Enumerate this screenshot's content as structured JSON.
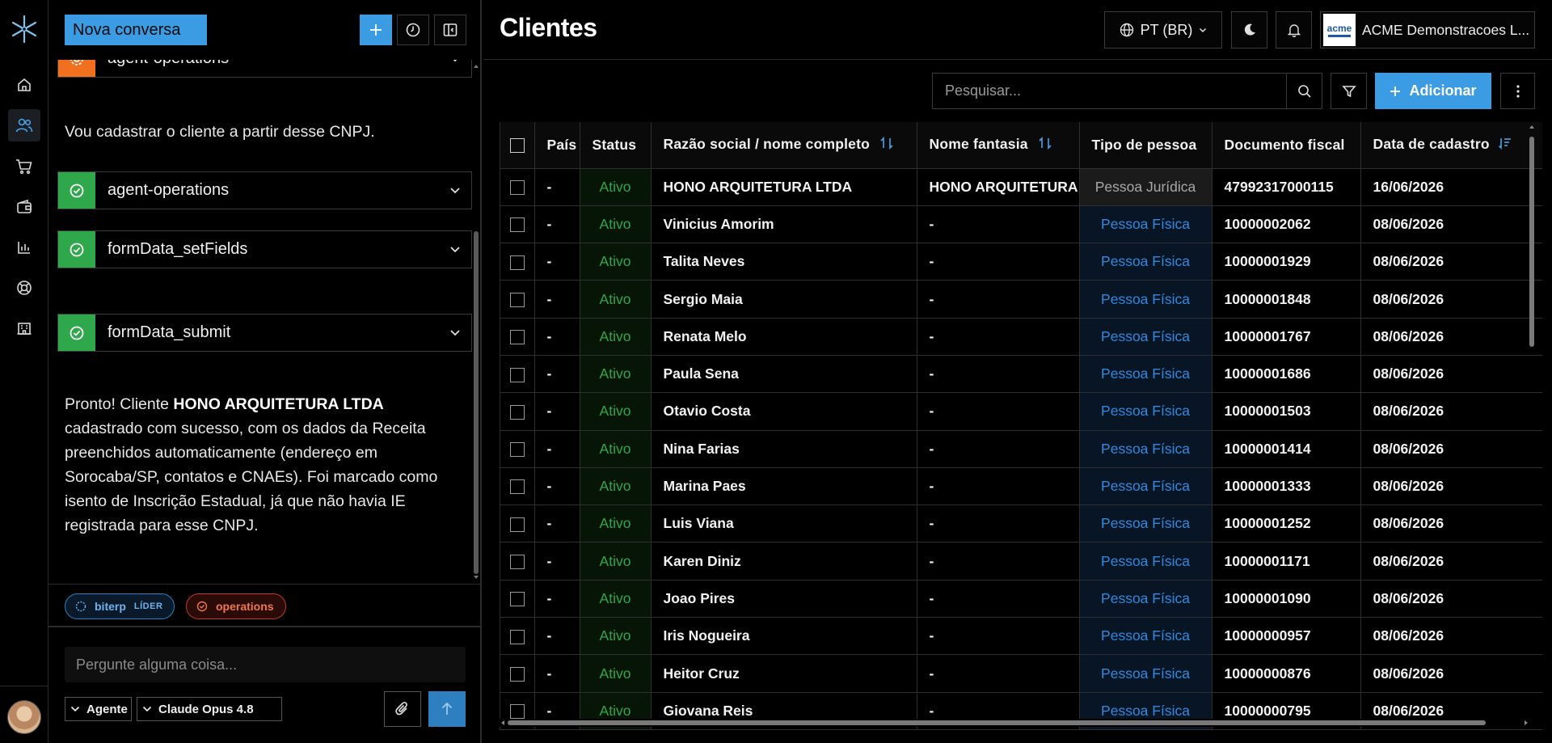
{
  "sidebar": {
    "nav": [
      {
        "icon": "home-icon"
      },
      {
        "icon": "users-icon",
        "active": true
      },
      {
        "icon": "cart-icon"
      },
      {
        "icon": "wallet-icon"
      },
      {
        "icon": "bar-chart-icon"
      },
      {
        "icon": "lifebuoy-icon"
      },
      {
        "icon": "building-icon"
      }
    ]
  },
  "chat": {
    "new_conversation": "Nova conversa",
    "tools": {
      "top_partial": "agent-operations",
      "t1": "agent-operations",
      "t2": "formData_setFields",
      "t3": "formData_submit"
    },
    "message1": "Vou cadastrar o cliente a partir desse CNPJ.",
    "message2": {
      "prefix": "Pronto! Cliente ",
      "bold": "HONO ARQUITETURA LTDA",
      "suffix": " cadastrado com sucesso, com os dados da Receita preenchidos automaticamente (endereço em Sorocaba/SP, contatos e CNAEs). Foi marcado como isento de Inscrição Estadual, já que não havia IE registrada para esse CNPJ."
    },
    "chips": {
      "agent1": "biterp",
      "agent1_role": "LÍDER",
      "agent2": "operations"
    },
    "input_placeholder": "Pergunte alguma coisa...",
    "mode": "Agente",
    "model": "Claude Opus 4.8"
  },
  "header": {
    "title": "Clientes",
    "language": "PT (BR)",
    "org": "ACME Demonstracoes L...",
    "org_logo_text": "acme"
  },
  "toolbar": {
    "search_placeholder": "Pesquisar...",
    "add_label": "Adicionar"
  },
  "table": {
    "columns": [
      "País",
      "Status",
      "Razão social / nome completo",
      "Nome fantasia",
      "Tipo de pessoa",
      "Documento fiscal",
      "Data de cadastro"
    ],
    "rows": [
      {
        "pais": "-",
        "status": "Ativo",
        "razao": "HONO ARQUITETURA LTDA",
        "fantasia": "HONO ARQUITETURA",
        "tipo": "Pessoa Jurídica",
        "doc": "47992317000115",
        "data": "16/06/2026"
      },
      {
        "pais": "-",
        "status": "Ativo",
        "razao": "Vinicius Amorim",
        "fantasia": "-",
        "tipo": "Pessoa Física",
        "doc": "10000002062",
        "data": "08/06/2026"
      },
      {
        "pais": "-",
        "status": "Ativo",
        "razao": "Talita Neves",
        "fantasia": "-",
        "tipo": "Pessoa Física",
        "doc": "10000001929",
        "data": "08/06/2026"
      },
      {
        "pais": "-",
        "status": "Ativo",
        "razao": "Sergio Maia",
        "fantasia": "-",
        "tipo": "Pessoa Física",
        "doc": "10000001848",
        "data": "08/06/2026"
      },
      {
        "pais": "-",
        "status": "Ativo",
        "razao": "Renata Melo",
        "fantasia": "-",
        "tipo": "Pessoa Física",
        "doc": "10000001767",
        "data": "08/06/2026"
      },
      {
        "pais": "-",
        "status": "Ativo",
        "razao": "Paula Sena",
        "fantasia": "-",
        "tipo": "Pessoa Física",
        "doc": "10000001686",
        "data": "08/06/2026"
      },
      {
        "pais": "-",
        "status": "Ativo",
        "razao": "Otavio Costa",
        "fantasia": "-",
        "tipo": "Pessoa Física",
        "doc": "10000001503",
        "data": "08/06/2026"
      },
      {
        "pais": "-",
        "status": "Ativo",
        "razao": "Nina Farias",
        "fantasia": "-",
        "tipo": "Pessoa Física",
        "doc": "10000001414",
        "data": "08/06/2026"
      },
      {
        "pais": "-",
        "status": "Ativo",
        "razao": "Marina Paes",
        "fantasia": "-",
        "tipo": "Pessoa Física",
        "doc": "10000001333",
        "data": "08/06/2026"
      },
      {
        "pais": "-",
        "status": "Ativo",
        "razao": "Luis Viana",
        "fantasia": "-",
        "tipo": "Pessoa Física",
        "doc": "10000001252",
        "data": "08/06/2026"
      },
      {
        "pais": "-",
        "status": "Ativo",
        "razao": "Karen Diniz",
        "fantasia": "-",
        "tipo": "Pessoa Física",
        "doc": "10000001171",
        "data": "08/06/2026"
      },
      {
        "pais": "-",
        "status": "Ativo",
        "razao": "Joao Pires",
        "fantasia": "-",
        "tipo": "Pessoa Física",
        "doc": "10000001090",
        "data": "08/06/2026"
      },
      {
        "pais": "-",
        "status": "Ativo",
        "razao": "Iris Nogueira",
        "fantasia": "-",
        "tipo": "Pessoa Física",
        "doc": "10000000957",
        "data": "08/06/2026"
      },
      {
        "pais": "-",
        "status": "Ativo",
        "razao": "Heitor Cruz",
        "fantasia": "-",
        "tipo": "Pessoa Física",
        "doc": "10000000876",
        "data": "08/06/2026"
      },
      {
        "pais": "-",
        "status": "Ativo",
        "razao": "Giovana Reis",
        "fantasia": "-",
        "tipo": "Pessoa Física",
        "doc": "10000000795",
        "data": "08/06/2026"
      }
    ]
  },
  "colors": {
    "accent": "#3b9be3",
    "success": "#2ea84a",
    "warning": "#f07020",
    "link_blue": "#2f8ae0"
  }
}
